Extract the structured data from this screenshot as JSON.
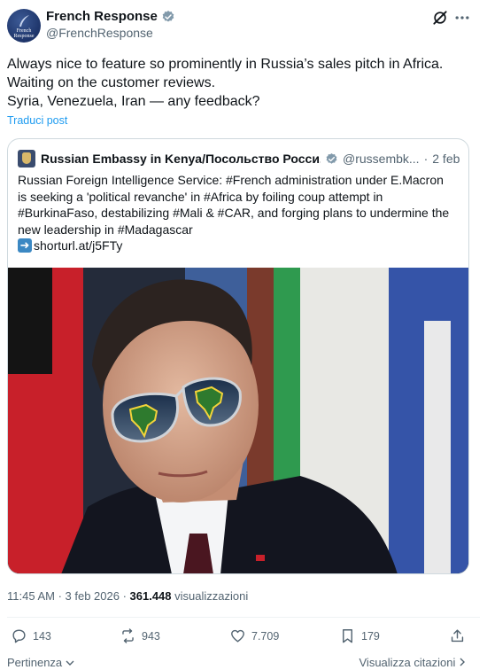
{
  "author": {
    "display_name": "French Response",
    "handle": "@FrenchResponse",
    "avatar_text": "French Response"
  },
  "post": {
    "lines": [
      "Always nice to feature so prominently in Russia’s sales pitch in Africa.",
      "Waiting on the customer reviews.",
      "Syria, Venezuela, Iran — any feedback?"
    ],
    "translate_label": "Traduci post"
  },
  "quote": {
    "display_name": "Russian Embassy in Kenya/Посольство Росси...",
    "handle": "@russembk...",
    "separator": "·",
    "date": "2 feb",
    "lines": [
      "Russian Foreign Intelligence Service: #French administration under E.Macron",
      "is seeking a 'political revanche' in #Africa by foiling coup attempt in",
      "#BurkinaFaso, destabilizing #Mali & #CAR, and forging plans to undermine the",
      "new leadership in #Madagascar"
    ],
    "link_text": "shorturl.at/j5FTy"
  },
  "meta": {
    "time_date": "11:45 AM · 3 feb 2026 · ",
    "views_count": "361.448",
    "views_label": " visualizzazioni"
  },
  "actions": {
    "replies": "143",
    "reposts": "943",
    "likes": "7.709",
    "bookmarks": "179"
  },
  "footer": {
    "relevance_label": "Pertinenza",
    "quotes_label": "Visualizza citazioni"
  },
  "colors": {
    "accent": "#1d9bf0",
    "secondary_text": "#536471",
    "primary_text": "#0f1419",
    "border": "#cfd9de"
  },
  "icons": [
    "verified-badge-icon",
    "grok-icon",
    "more-icon",
    "reply-icon",
    "repost-icon",
    "like-icon",
    "bookmark-icon",
    "share-icon",
    "chevron-down-icon",
    "chevron-right-icon",
    "arrow-right-icon"
  ]
}
